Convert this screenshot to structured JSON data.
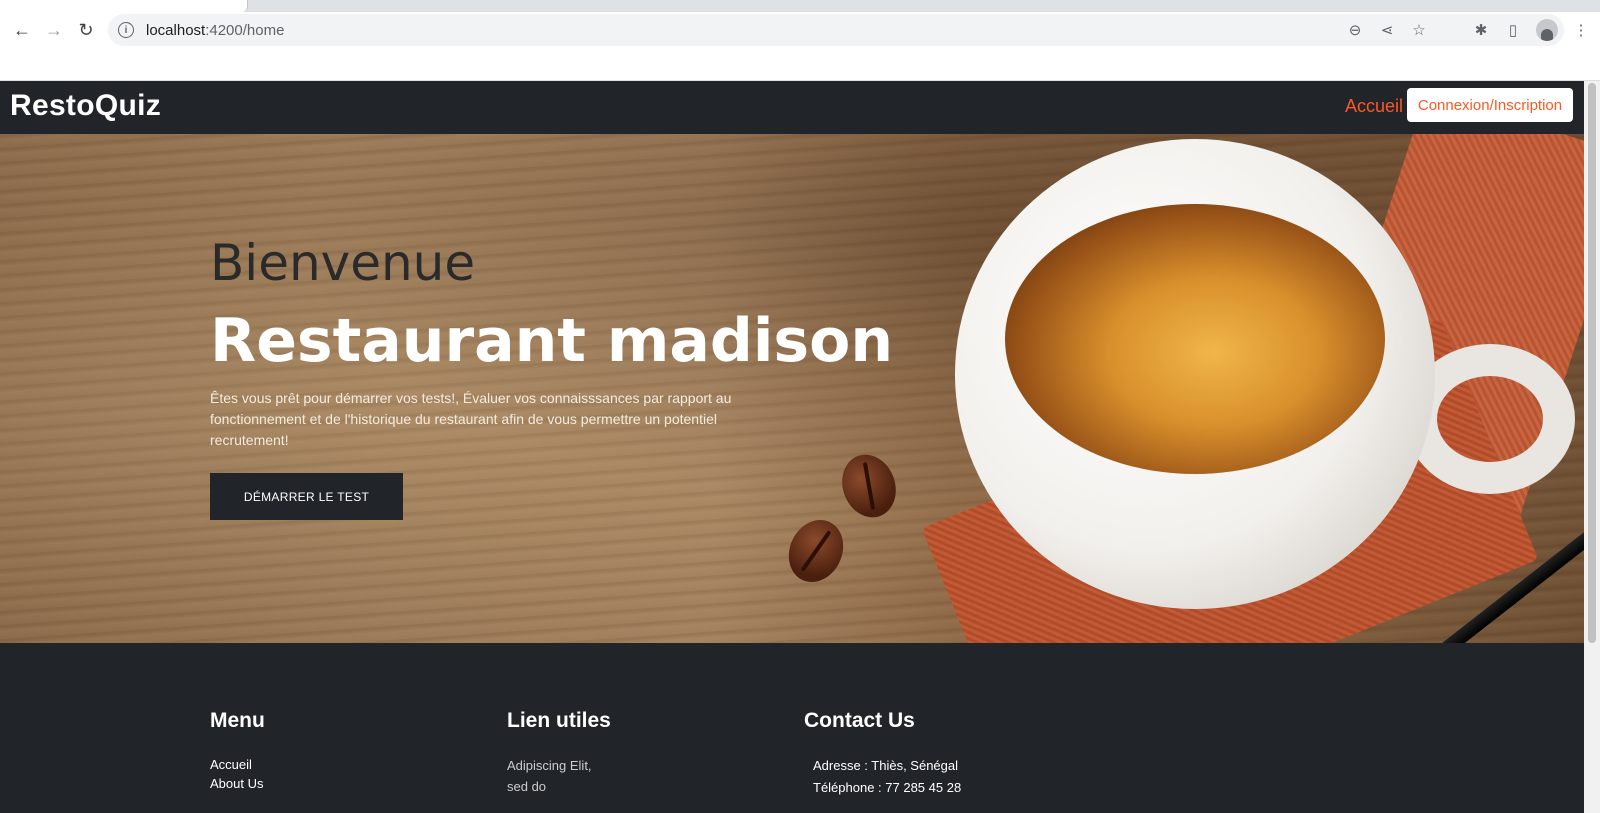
{
  "browser": {
    "url_host": "localhost",
    "url_path": ":4200/home"
  },
  "navbar": {
    "brand": "RestoQuiz",
    "link_home": "Accueil",
    "login_button": "Connexion/Inscription"
  },
  "hero": {
    "subtitle": "Bienvenue",
    "title": "Restaurant madison",
    "text": "Êtes vous prêt pour démarrer vos tests!, Évaluer vos connaisssances par rapport au fonctionnement et de l'historique du restaurant afin de vous permettre un potentiel recrutement!",
    "cta": "DÉMARRER LE TEST"
  },
  "footer": {
    "menu": {
      "title": "Menu",
      "items": [
        "Accueil",
        "About Us"
      ]
    },
    "links": {
      "title": "Lien utiles",
      "lines": [
        "Adipiscing Elit,",
        "sed do"
      ]
    },
    "contact": {
      "title": "Contact Us",
      "address": "Adresse : Thiès, Sénégal",
      "phone": "Téléphone : 77 285 45 28"
    }
  }
}
